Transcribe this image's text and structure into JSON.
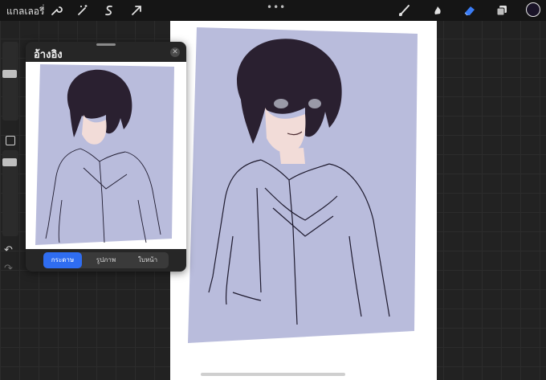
{
  "topbar": {
    "gallery_label": "แกลเลอรี่",
    "more_label": "•••",
    "tools": [
      "wrench-icon",
      "magic-wand-icon",
      "selection-icon",
      "transform-arrow-icon",
      "brush-icon",
      "smudge-icon",
      "eraser-icon",
      "layers-icon"
    ],
    "active_tool": "eraser-icon",
    "current_color": "#1a1428"
  },
  "sidebar": {
    "undo_label": "↶",
    "redo_label": "↷"
  },
  "reference": {
    "title": "อ้างอิง",
    "close_label": "✕",
    "tabs": [
      {
        "label": "กระดาษ",
        "active": true
      },
      {
        "label": "รูปภาพ",
        "active": false
      },
      {
        "label": "ใบหน้า",
        "active": false
      }
    ]
  },
  "colors": {
    "accent": "#2f6df1",
    "artwork_background": "#b9bcdc"
  }
}
